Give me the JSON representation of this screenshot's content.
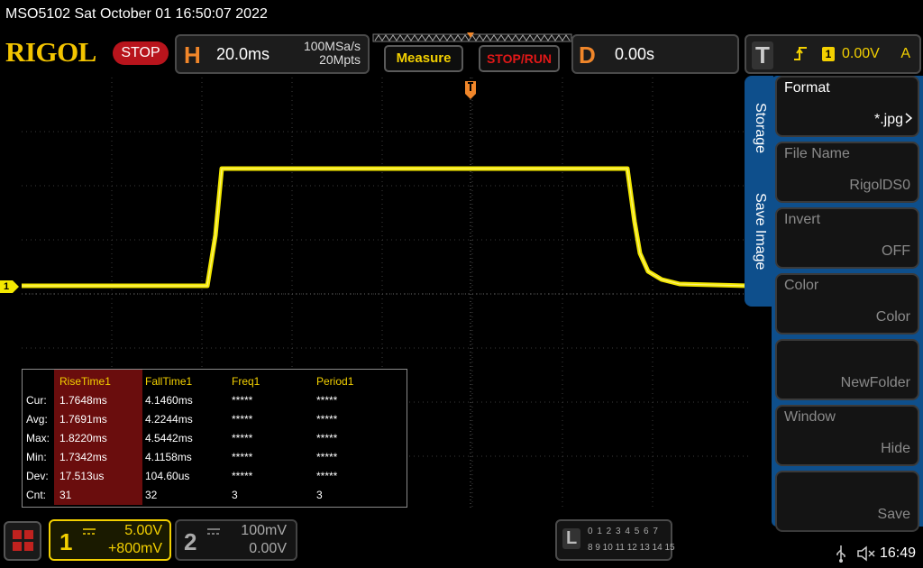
{
  "status_line": "MSO5102  Sat October 01 16:50:07 2022",
  "brand": "RIGOL",
  "run_state": "STOP",
  "horizontal": {
    "letter": "H",
    "timebase": "20.0ms",
    "sample_rate": "100MSa/s",
    "memory_depth": "20Mpts"
  },
  "buttons": {
    "measure": "Measure",
    "stop_run": "STOP/RUN"
  },
  "delay": {
    "letter": "D",
    "value": "0.00s"
  },
  "trigger": {
    "letter": "T",
    "channel_badge": "1",
    "level": "0.00V",
    "mode": "A"
  },
  "channel_marker": "1",
  "side_tabs": [
    "Storage",
    "Save Image"
  ],
  "menu": [
    {
      "title": "Format",
      "value": "*.jpg"
    },
    {
      "title": "File Name",
      "value": "RigolDS0"
    },
    {
      "title": "Invert",
      "value": "OFF"
    },
    {
      "title": "Color",
      "value": "Color"
    },
    {
      "title": "",
      "value": "NewFolder"
    },
    {
      "title": "Window",
      "value": "Hide"
    },
    {
      "title": "",
      "value": "Save"
    }
  ],
  "measurements": {
    "headers": [
      "RiseTime1",
      "FallTime1",
      "Freq1",
      "Period1"
    ],
    "rows": [
      {
        "label": "Cur:",
        "values": [
          "1.7648ms",
          "4.1460ms",
          "*****",
          "*****"
        ]
      },
      {
        "label": "Avg:",
        "values": [
          "1.7691ms",
          "4.2244ms",
          "*****",
          "*****"
        ]
      },
      {
        "label": "Max:",
        "values": [
          "1.8220ms",
          "4.5442ms",
          "*****",
          "*****"
        ]
      },
      {
        "label": "Min:",
        "values": [
          "1.7342ms",
          "4.1158ms",
          "*****",
          "*****"
        ]
      },
      {
        "label": "Dev:",
        "values": [
          "17.513us",
          "104.60us",
          "*****",
          "*****"
        ]
      },
      {
        "label": "Cnt:",
        "values": [
          "31",
          "32",
          "3",
          "3"
        ]
      }
    ]
  },
  "ch1": {
    "number": "1",
    "scale": "5.00V",
    "offset": "+800mV"
  },
  "ch2": {
    "number": "2",
    "scale": "100mV",
    "offset": "0.00V"
  },
  "logic": {
    "letter": "L",
    "row1": "0 1 2 3  4 5 6 7",
    "row2": "8 9 10 11 12 13 14 15"
  },
  "clock": "16:49",
  "colors": {
    "trace": "#f3e800",
    "accent_orange": "#f0862a",
    "menu_blue": "#0e4f8c",
    "stop_red": "#b8141c"
  }
}
